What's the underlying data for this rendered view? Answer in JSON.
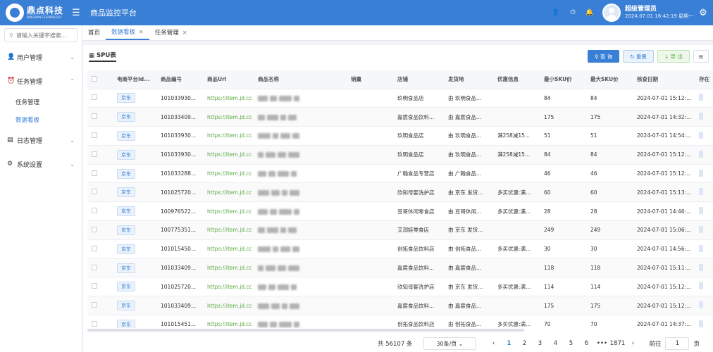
{
  "header": {
    "logo_cn": "鼎点科技",
    "logo_en": "DINGDIAN TECHNOLOGY",
    "app_title": "商品监控平台",
    "user_name": "超级管理员",
    "user_time": "2024.07.01 16:42:19 星期一"
  },
  "sidebar": {
    "search_placeholder": "请输入关键字搜索...",
    "items": [
      {
        "label": "用户管理"
      },
      {
        "label": "任务管理"
      },
      {
        "label": "任务管理"
      },
      {
        "label": "数据看板"
      },
      {
        "label": "日志管理"
      },
      {
        "label": "系统设置"
      }
    ]
  },
  "tabs": [
    {
      "label": "首页"
    },
    {
      "label": "数据看板"
    },
    {
      "label": "任务管理"
    }
  ],
  "card": {
    "title": "SPU表",
    "btn_query": "查 询",
    "btn_reset": "重置",
    "btn_export": "导 出"
  },
  "table": {
    "columns": [
      "电商平台Id...",
      "商品编号",
      "商品Url",
      "商品名称",
      "销量",
      "店铺",
      "发货地",
      "优惠信息",
      "最小SKU价",
      "最大SKU价",
      "核查日期",
      "存在"
    ],
    "rows": [
      {
        "platform": "京东",
        "id": "101033930...",
        "url": "https://item.jd.cc",
        "shop": "玖明食品店",
        "ship": "由 玖明食品...",
        "promo": "",
        "min": "84",
        "max": "84",
        "date": "2024-07-01 15:12:..."
      },
      {
        "platform": "京东",
        "id": "101033409...",
        "url": "https://item.jd.cc",
        "shop": "嘉宸食品饮料...",
        "ship": "由 嘉宸食品...",
        "promo": "",
        "min": "175",
        "max": "175",
        "date": "2024-07-01 14:32:..."
      },
      {
        "platform": "京东",
        "id": "101033930...",
        "url": "https://item.jd.cc",
        "shop": "玖明食品店",
        "ship": "由 玖明食品...",
        "promo": "满258减15...",
        "min": "51",
        "max": "51",
        "date": "2024-07-01 14:54:..."
      },
      {
        "platform": "京东",
        "id": "101033930...",
        "url": "https://item.jd.cc",
        "shop": "玖明食品店",
        "ship": "由 玖明食品...",
        "promo": "满258减15...",
        "min": "84",
        "max": "84",
        "date": "2024-07-01 15:12:..."
      },
      {
        "platform": "京东",
        "id": "101033288...",
        "url": "https://item.jd.cc",
        "shop": "广翰食品专营店",
        "ship": "由 广翰食品...",
        "promo": "",
        "min": "46",
        "max": "46",
        "date": "2024-07-01 15:12:..."
      },
      {
        "platform": "京东",
        "id": "101025720...",
        "url": "https://item.jd.cc",
        "shop": "欣知母婴洗护店",
        "ship": "由 京东 发货...",
        "promo": "多买优惠:满...",
        "min": "60",
        "max": "60",
        "date": "2024-07-01 15:13:..."
      },
      {
        "platform": "京东",
        "id": "100976522...",
        "url": "https://item.jd.cc",
        "shop": "豆哥休闲零食店",
        "ship": "由 豆哥休闲...",
        "promo": "多买优惠:满...",
        "min": "28",
        "max": "28",
        "date": "2024-07-01 14:46:..."
      },
      {
        "platform": "京东",
        "id": "100775351...",
        "url": "https://item.jd.cc",
        "shop": "艾润娃零食店",
        "ship": "由 京东 发货...",
        "promo": "",
        "min": "249",
        "max": "249",
        "date": "2024-07-01 15:06:..."
      },
      {
        "platform": "京东",
        "id": "101015450...",
        "url": "https://item.jd.cc",
        "shop": "创拓食品饮料店",
        "ship": "由 创拓食品...",
        "promo": "多买优惠:满...",
        "min": "30",
        "max": "30",
        "date": "2024-07-01 14:56:..."
      },
      {
        "platform": "京东",
        "id": "101033409...",
        "url": "https://item.jd.cc",
        "shop": "嘉宸食品饮料...",
        "ship": "由 嘉宸食品...",
        "promo": "",
        "min": "118",
        "max": "118",
        "date": "2024-07-01 15:11:..."
      },
      {
        "platform": "京东",
        "id": "101025720...",
        "url": "https://item.jd.cc",
        "shop": "欣知母婴洗护店",
        "ship": "由 京东 发货...",
        "promo": "多买优惠:满...",
        "min": "114",
        "max": "114",
        "date": "2024-07-01 15:12:..."
      },
      {
        "platform": "京东",
        "id": "101033409...",
        "url": "https://item.jd.cc",
        "shop": "嘉宸食品饮料...",
        "ship": "由 嘉宸食品...",
        "promo": "",
        "min": "175",
        "max": "175",
        "date": "2024-07-01 15:12:..."
      },
      {
        "platform": "京东",
        "id": "101015451...",
        "url": "https://item.jd.cc",
        "shop": "创拓食品饮料店",
        "ship": "由 创拓食品...",
        "promo": "多买优惠:满...",
        "min": "70",
        "max": "70",
        "date": "2024-07-01 14:37:..."
      }
    ]
  },
  "pager": {
    "total": "共 56107 条",
    "size": "30条/页",
    "prev": "‹",
    "pages": [
      "1",
      "2",
      "3",
      "4",
      "5",
      "6",
      "•••",
      "1871"
    ],
    "next": "›",
    "goto_label": "前往",
    "goto_value": "1",
    "goto_suffix": "页"
  }
}
